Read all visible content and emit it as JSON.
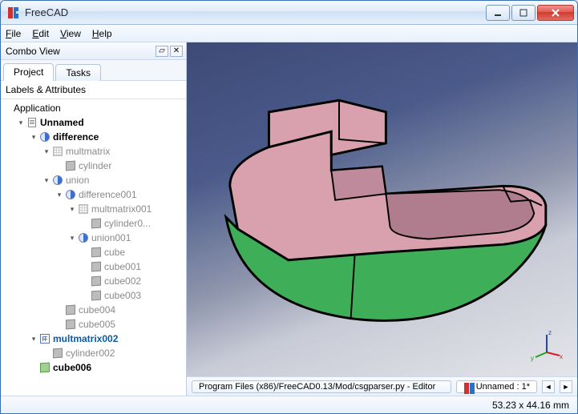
{
  "window": {
    "title": "FreeCAD"
  },
  "menu": {
    "file": "File",
    "edit": "Edit",
    "view": "View",
    "help": "Help"
  },
  "panel": {
    "title": "Combo View",
    "tabs": {
      "project": "Project",
      "tasks": "Tasks"
    },
    "section": "Labels & Attributes"
  },
  "tree": {
    "application": "Application",
    "doc": "Unnamed",
    "difference": "difference",
    "multmatrix": "multmatrix",
    "cylinder": "cylinder",
    "union": "union",
    "difference001": "difference001",
    "multmatrix001": "multmatrix001",
    "cylinder0": "cylinder0...",
    "union001": "union001",
    "cube": "cube",
    "cube001": "cube001",
    "cube002": "cube002",
    "cube003": "cube003",
    "cube004": "cube004",
    "cube005": "cube005",
    "multmatrix002": "multmatrix002",
    "cylinder002": "cylinder002",
    "cube006": "cube006"
  },
  "doctabs": {
    "path": "Program Files (x86)/FreeCAD0.13/Mod/csgparser.py - Editor",
    "active": "Unnamed : 1*"
  },
  "status": {
    "dims": "53.23 x 44.16 mm"
  },
  "axes": {
    "x": "x",
    "y": "y",
    "z": "z"
  }
}
